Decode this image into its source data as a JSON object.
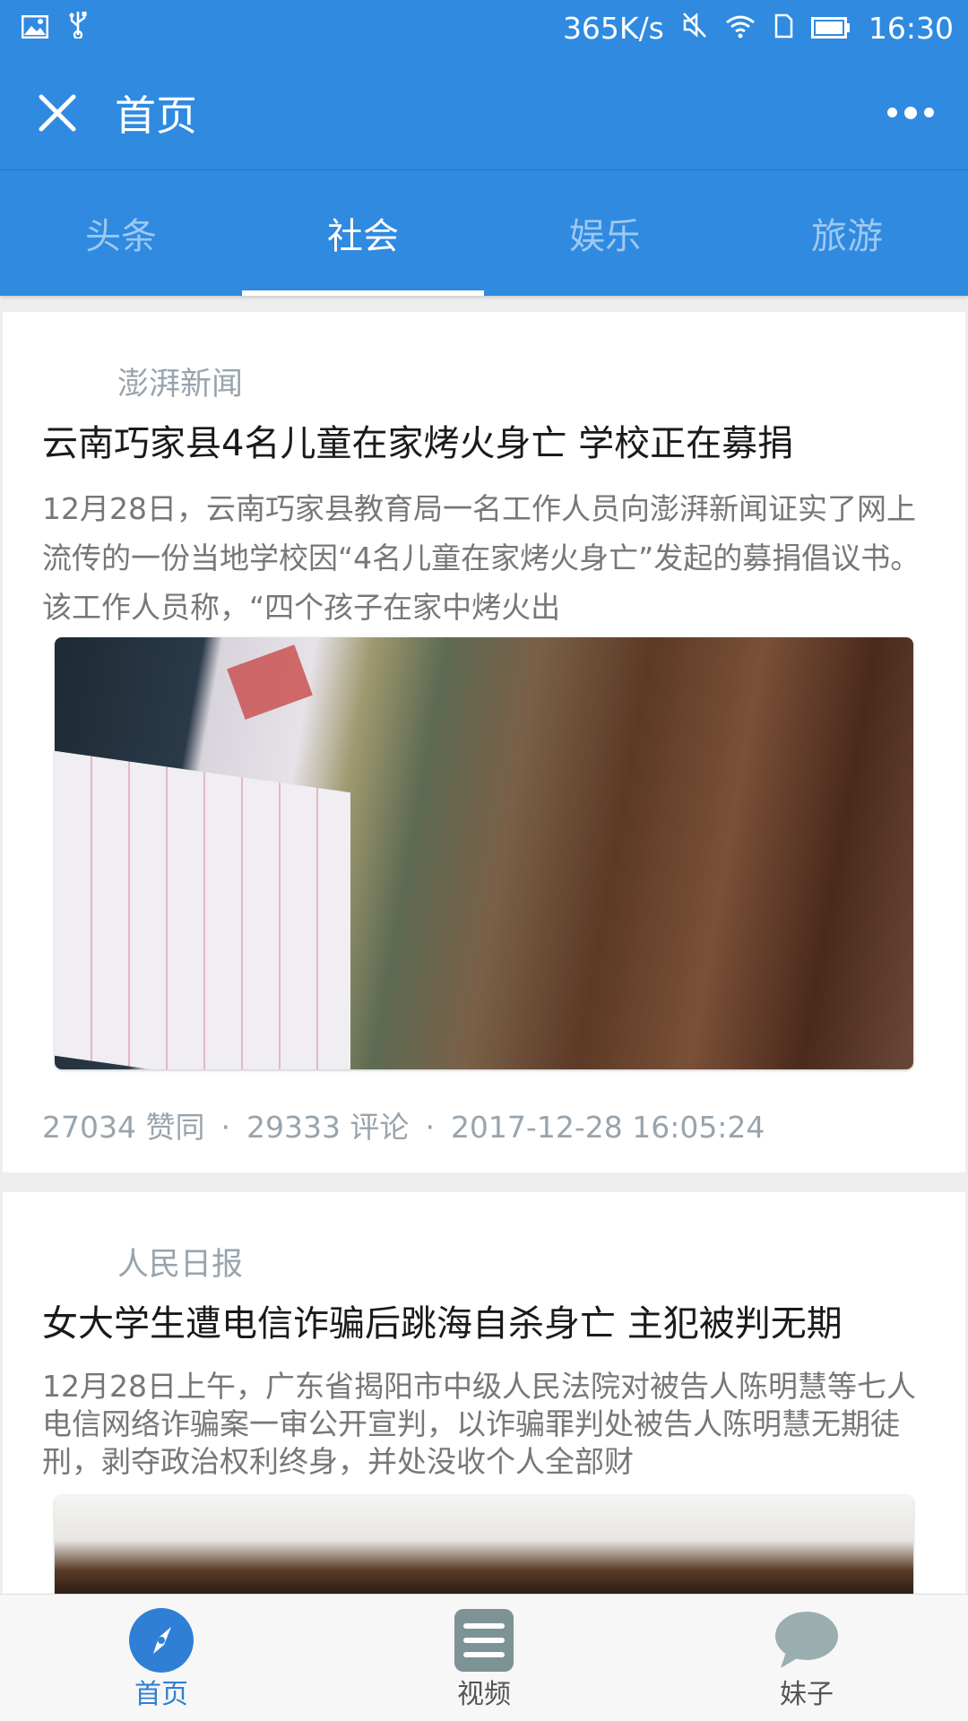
{
  "status_bar": {
    "speed": "365K/s",
    "time": "16:30"
  },
  "app_bar": {
    "title": "首页"
  },
  "tabs": [
    {
      "label": "头条",
      "active": false
    },
    {
      "label": "社会",
      "active": true
    },
    {
      "label": "娱乐",
      "active": false
    },
    {
      "label": "旅游",
      "active": false
    }
  ],
  "articles": [
    {
      "source": "澎湃新闻",
      "headline": "云南巧家县4名儿童在家烤火身亡 学校正在募捐",
      "summary": "12月28日，云南巧家县教育局一名工作人员向澎湃新闻证实了网上流传的一份当地学校因“4名儿童在家烤火身亡”发起的募捐倡议书。该工作人员称，“四个孩子在家中烤火出",
      "likes": "27034 赞同",
      "comments": "29333 评论",
      "time": "2017-12-28 16:05:24"
    },
    {
      "source": "人民日报",
      "headline": "女大学生遭电信诈骗后跳海自杀身亡 主犯被判无期",
      "summary": "12月28日上午，广东省揭阳市中级人民法院对被告人陈明慧等七人电信网络诈骗案一审公开宣判，以诈骗罪判处被告人陈明慧无期徒刑，剥夺政治权利终身，并处没收个人全部财"
    }
  ],
  "bottom_nav": [
    {
      "label": "首页",
      "icon": "compass-icon",
      "active": true
    },
    {
      "label": "视频",
      "icon": "list-icon",
      "active": false
    },
    {
      "label": "妹子",
      "icon": "chat-bubble-icon",
      "active": false
    }
  ],
  "colors": {
    "primary": "#2f8ae0",
    "tab_inactive": "#9cc8f2",
    "meta_gray": "#98a4ad",
    "nav_active": "#2f7fd6"
  }
}
